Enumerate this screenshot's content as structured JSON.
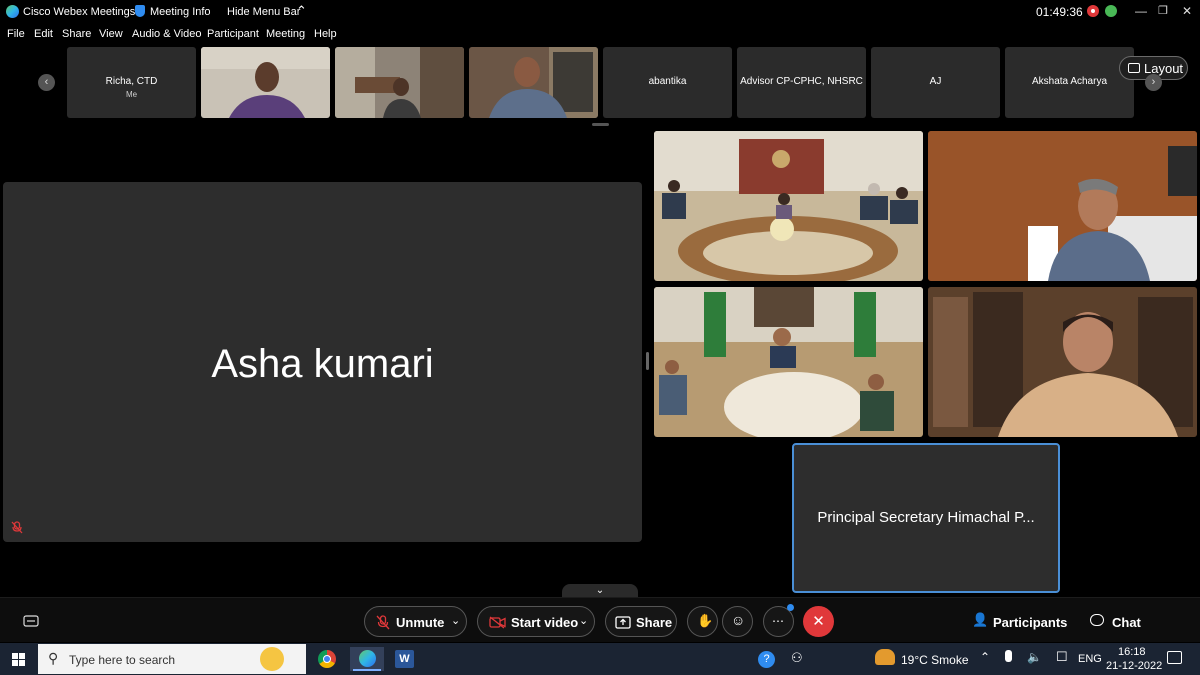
{
  "titlebar": {
    "app_name": "Cisco Webex Meetings",
    "meeting_info": "Meeting Info",
    "hide_menu": "Hide Menu Bar",
    "timer": "01:49:36"
  },
  "menu": [
    "File",
    "Edit",
    "Share",
    "View",
    "Audio & Video",
    "Participant",
    "Meeting",
    "Help"
  ],
  "strip": {
    "thumbnails": [
      {
        "name": "Richa, CTD",
        "sub": "Me"
      },
      {
        "name": "",
        "sub": ""
      },
      {
        "name": "",
        "sub": ""
      },
      {
        "name": "",
        "sub": ""
      },
      {
        "name": "abantika",
        "sub": ""
      },
      {
        "name": "Advisor CP-CPHC, NHSRC",
        "sub": ""
      },
      {
        "name": "AJ",
        "sub": ""
      },
      {
        "name": "Akshata Acharya",
        "sub": ""
      }
    ],
    "layout_label": "Layout"
  },
  "main": {
    "active_speaker": "Asha kumari",
    "side_tile_name": "Principal Secretary Himachal P..."
  },
  "controls": {
    "unmute": "Unmute",
    "start_video": "Start video",
    "share": "Share",
    "participants": "Participants",
    "chat": "Chat",
    "end_color": "#e0383a",
    "accent": "#2f8cf0"
  },
  "taskbar": {
    "search_placeholder": "Type here to search",
    "weather": "19°C  Smoke",
    "lang": "ENG",
    "time": "16:18",
    "date": "21-12-2022"
  }
}
